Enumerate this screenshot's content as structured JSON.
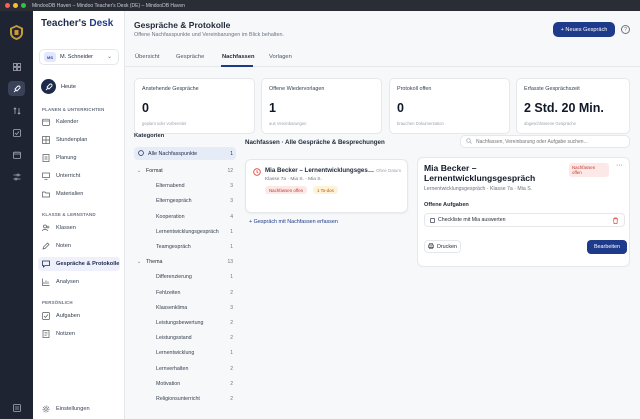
{
  "window": {
    "title": "MindooDB Haven – Mindoo Teacher's Desk (DE) – MindooDB Haven"
  },
  "brand": {
    "part1": "Teacher's ",
    "part2": "Desk"
  },
  "user": {
    "initials": "MS",
    "name": "M. Schneider"
  },
  "sidebar": {
    "today": "Heute",
    "sections": [
      {
        "title": "PLANEN & UNTERRICHTEN"
      },
      {
        "title": "KLASSE & LERNSTAND"
      },
      {
        "title": "PERSÖNLICH"
      }
    ],
    "items": [
      {
        "label": "Kalender"
      },
      {
        "label": "Stundenplan"
      },
      {
        "label": "Planung"
      },
      {
        "label": "Unterricht"
      },
      {
        "label": "Materialien"
      },
      {
        "label": "Klassen"
      },
      {
        "label": "Noten"
      },
      {
        "label": "Gespräche & Protokolle"
      },
      {
        "label": "Analysen"
      },
      {
        "label": "Aufgaben"
      },
      {
        "label": "Notizen"
      }
    ],
    "settings": "Einstellungen"
  },
  "header": {
    "title": "Gespräche & Protokolle",
    "subtitle": "Offene Nachfasspunkte und Vereinbarungen im Blick behalten.",
    "new_button": "+ Neues Gespräch",
    "help": "?"
  },
  "tabs": [
    {
      "label": "Übersicht"
    },
    {
      "label": "Gespräche"
    },
    {
      "label": "Nachfassen"
    },
    {
      "label": "Vorlagen"
    }
  ],
  "stats": [
    {
      "label": "Anstehende Gespräche",
      "value": "0",
      "hint": "geplant oder vorbereitet"
    },
    {
      "label": "Offene Wiedervorlagen",
      "value": "1",
      "hint": "aus Vereinbarungen"
    },
    {
      "label": "Protokoll offen",
      "value": "0",
      "hint": "brauchen Dokumentation"
    },
    {
      "label": "Erfasste Gesprächszeit",
      "value": "2 Std. 20 Min.",
      "hint": "abgeschlossene Gespräche"
    }
  ],
  "categories": {
    "title": "Kategorien",
    "all": {
      "label": "Alle Nachfasspunkte",
      "count": "1"
    },
    "rows": [
      {
        "label": "Format",
        "count": "12",
        "group": true
      },
      {
        "label": "Elternabend",
        "count": "3",
        "group": false
      },
      {
        "label": "Elterngespräch",
        "count": "3",
        "group": false
      },
      {
        "label": "Kooperation",
        "count": "4",
        "group": false
      },
      {
        "label": "Lernentwicklungsgespräch",
        "count": "1",
        "group": false
      },
      {
        "label": "Teamgespräch",
        "count": "1",
        "group": false
      },
      {
        "label": "Thema",
        "count": "13",
        "group": true
      },
      {
        "label": "Differenzierung",
        "count": "1",
        "group": false
      },
      {
        "label": "Fehlzeiten",
        "count": "2",
        "group": false
      },
      {
        "label": "Klassenklima",
        "count": "3",
        "group": false
      },
      {
        "label": "Leistungsbewertung",
        "count": "2",
        "group": false
      },
      {
        "label": "Leistungsstand",
        "count": "2",
        "group": false
      },
      {
        "label": "Lernentwicklung",
        "count": "1",
        "group": false
      },
      {
        "label": "Lernverhalten",
        "count": "2",
        "group": false
      },
      {
        "label": "Motivation",
        "count": "2",
        "group": false
      },
      {
        "label": "Religionsunterricht",
        "count": "2",
        "group": false
      }
    ]
  },
  "list": {
    "title": "Nachfassen · Alle Gespräche & Besprechungen",
    "search_placeholder": "Nachfassen, Vereinbarung oder Aufgabe suchen...",
    "items": [
      {
        "title": "Mia Becker – Lernentwicklungsgespräch",
        "date": "Ohne Datum",
        "meta": "Klasse 7a · Mia S. · Mia S.",
        "badge_status": "Nachfassen offen",
        "badge_todo": "1 To-dos"
      }
    ],
    "add_link": "+ Gespräch mit Nachfassen erfassen"
  },
  "detail": {
    "title": "Mia Becker – Lernentwicklungsgespräch",
    "badge": "Nachfassen offen",
    "meta": "Lernentwicklungsgespräch · Klasse 7a · Mia S.",
    "section": "Offene Aufgaben",
    "tasks": [
      {
        "label": "Checkliste mit Mia auswerten"
      }
    ],
    "print": "Drucken",
    "edit": "Bearbeiten",
    "more": "···"
  },
  "colors": {
    "accent": "#1e3a8a",
    "danger": "#c0392b",
    "warning": "#b45309",
    "rail": "#1f2433"
  }
}
